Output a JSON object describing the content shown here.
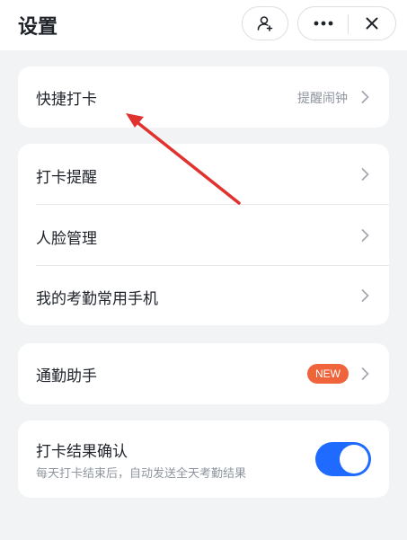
{
  "header": {
    "title": "设置"
  },
  "icons": {
    "contact": "add-contact-icon",
    "more": "more-dots-icon",
    "close": "close-icon",
    "chevron": "chevron-right-icon"
  },
  "card1": {
    "label": "快捷打卡",
    "right": "提醒闹钟"
  },
  "card2": {
    "items": [
      "打卡提醒",
      "人脸管理",
      "我的考勤常用手机"
    ]
  },
  "card3": {
    "label": "通勤助手",
    "badge": "NEW"
  },
  "card4": {
    "label": "打卡结果确认",
    "subtitle": "每天打卡结束后，自动发送全天考勤结果",
    "toggle_on": true
  },
  "colors": {
    "accent": "#1f6bff",
    "badge": "#f0643c",
    "annotation_arrow": "#e0322f"
  }
}
